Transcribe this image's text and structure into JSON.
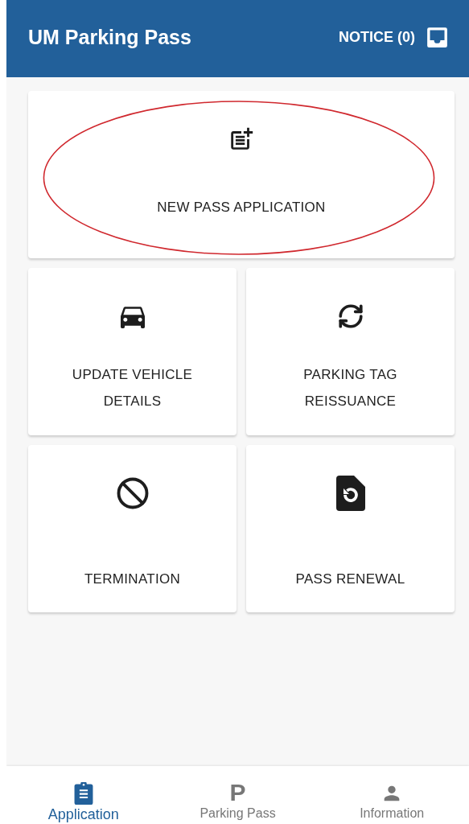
{
  "app_bar": {
    "title": "UM Parking Pass",
    "notice": "NOTICE (0)"
  },
  "tiles": [
    {
      "label": "NEW PASS APPLICATION",
      "wide": true,
      "circled": true
    },
    {
      "label": "UPDATE VEHICLE DETAILS",
      "wide": false,
      "circled": false
    },
    {
      "label": "PARKING TAG REISSUANCE",
      "wide": false,
      "circled": false
    },
    {
      "label": "TERMINATION",
      "wide": false,
      "circled": false
    },
    {
      "label": "PASS RENEWAL",
      "wide": false,
      "circled": false
    }
  ],
  "bottom_nav": [
    {
      "label": "Application",
      "selected": true
    },
    {
      "label": "Parking Pass",
      "glyph": "P",
      "selected": false
    },
    {
      "label": "Information",
      "selected": false
    }
  ]
}
